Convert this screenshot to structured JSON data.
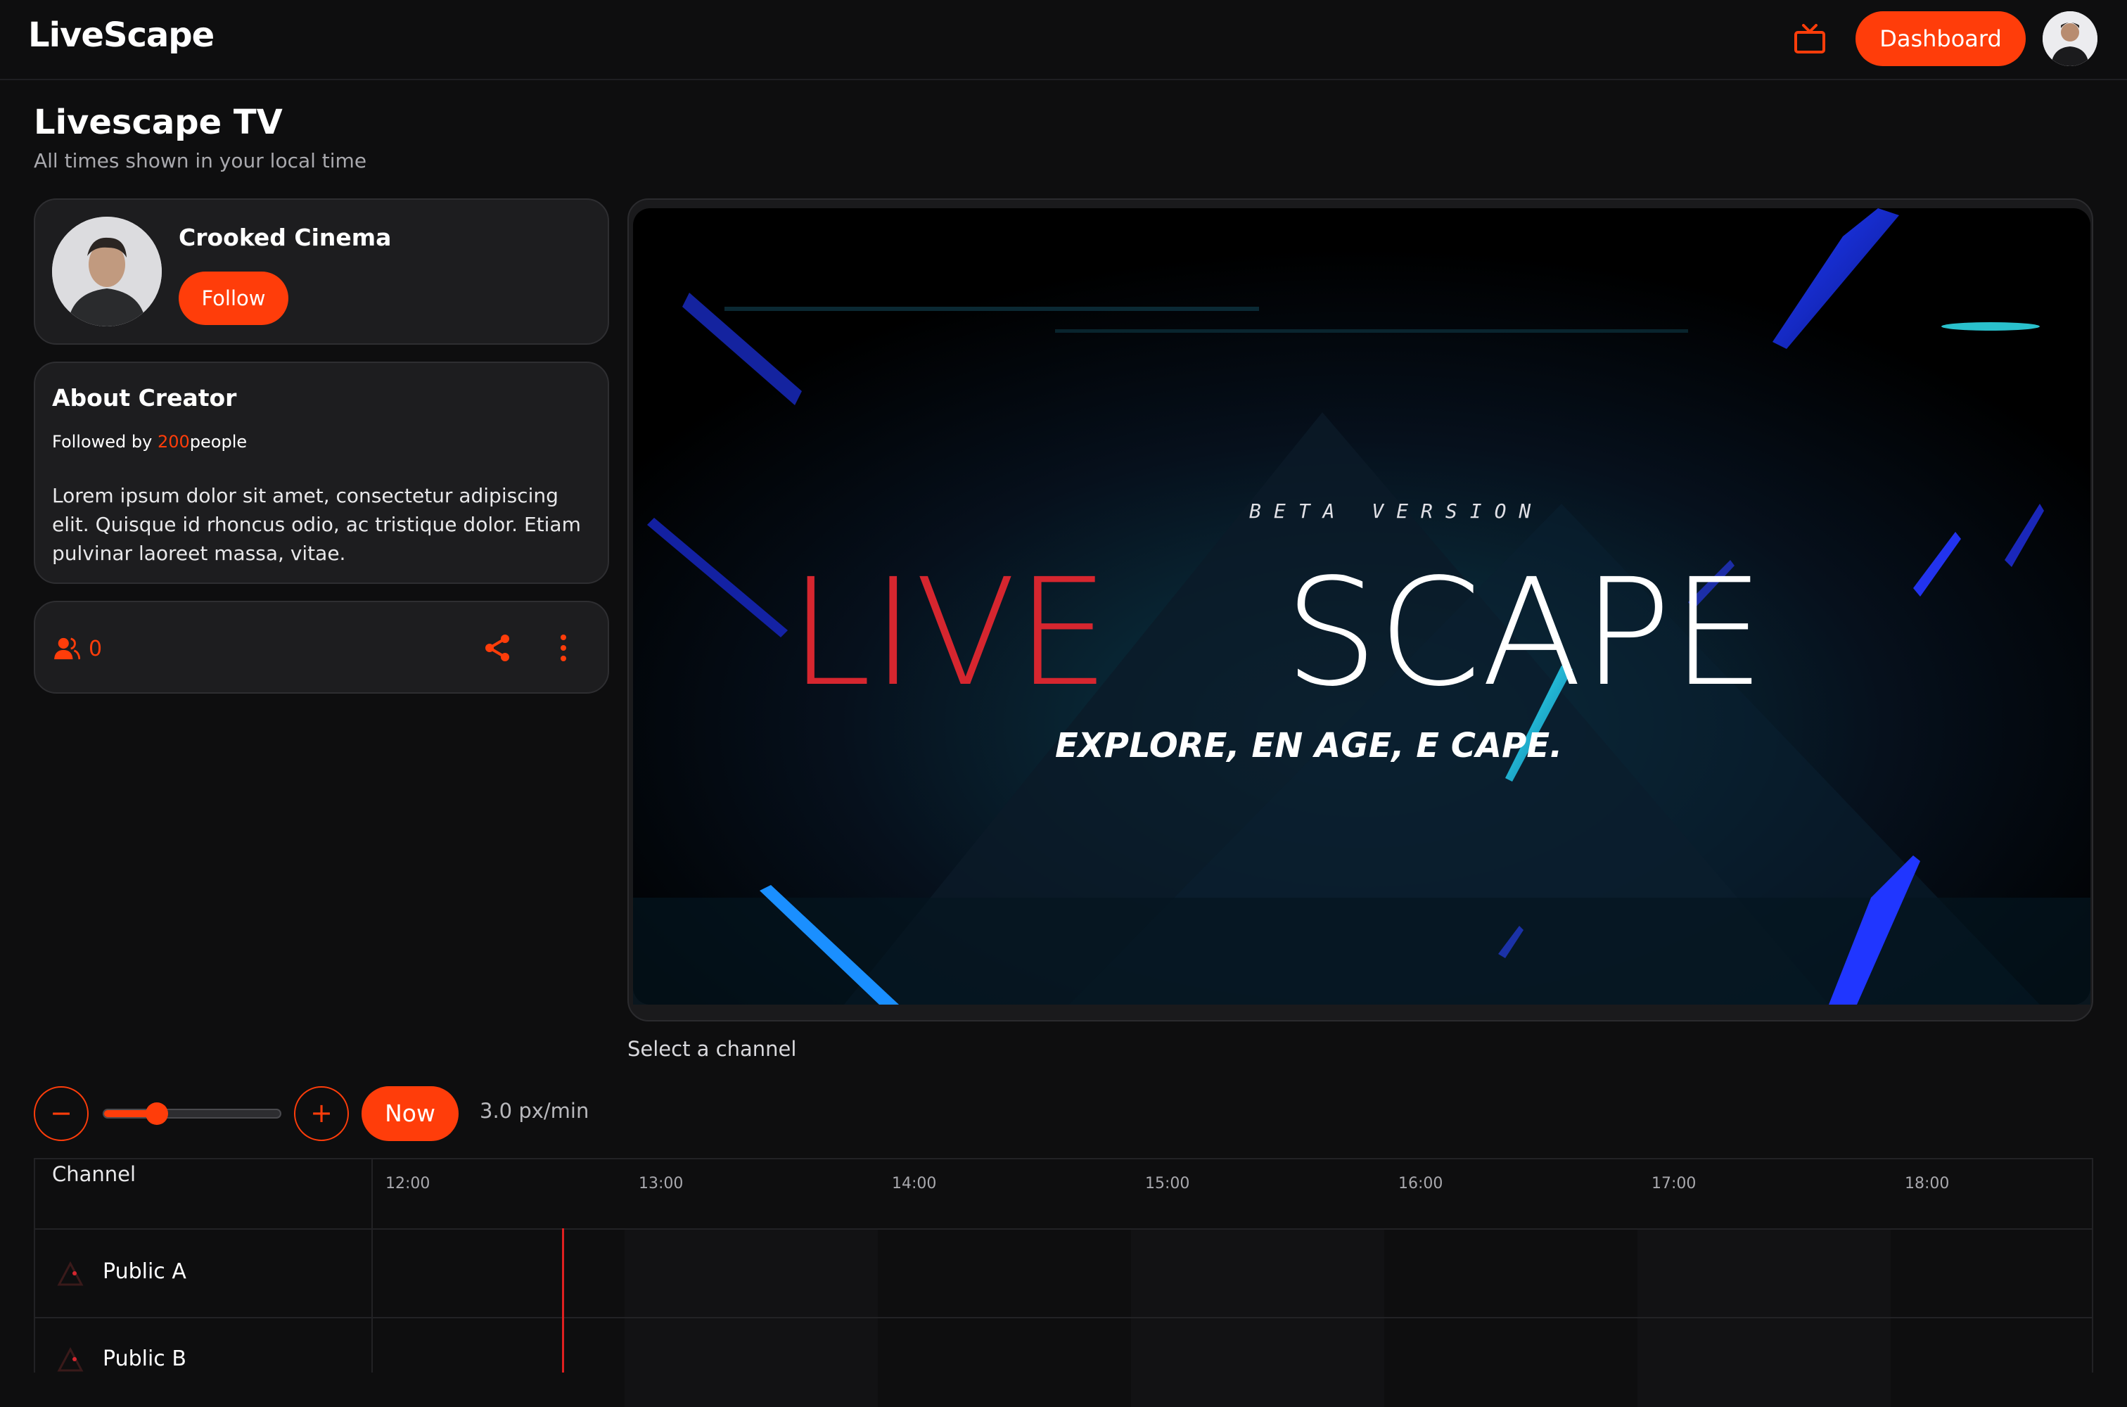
{
  "app": {
    "logo": "LiveScape"
  },
  "topbar": {
    "dashboard_label": "Dashboard"
  },
  "page": {
    "title": "Livescape TV",
    "subtitle": "All times shown in your local time"
  },
  "creator": {
    "name": "Crooked Cinema",
    "follow_label": "Follow"
  },
  "about": {
    "title": "About Creator",
    "followed_prefix": "Followed by ",
    "followed_count": "200",
    "followed_suffix": "people",
    "body": "Lorem ipsum dolor sit amet, consectetur adipiscing elit. Quisque id rhoncus odio, ac tristique dolor. Etiam pulvinar laoreet massa, vitae."
  },
  "actions": {
    "viewer_count": "0"
  },
  "player": {
    "beta_text": "BETA VERSION",
    "brand_left": "LIVE",
    "brand_right": "SCAPE",
    "tagline": "EXPLORE, EN  AGE, E  CAPE.",
    "caption": "Select a channel"
  },
  "timeline": {
    "zoom_out": "−",
    "zoom_in": "+",
    "zoom_level": 0.3,
    "now_label": "Now",
    "zoom_label": "3.0 px/min",
    "channel_header": "Channel",
    "times": [
      "12:00",
      "13:00",
      "14:00",
      "15:00",
      "16:00",
      "17:00",
      "18:00"
    ],
    "channels": [
      {
        "name": "Public A"
      },
      {
        "name": "Public B"
      }
    ]
  },
  "colors": {
    "accent": "#ff3d0a",
    "background": "#0e0e0f",
    "card": "#1d1d1f",
    "now_line": "#e02020",
    "brand_red": "#d6262f"
  }
}
